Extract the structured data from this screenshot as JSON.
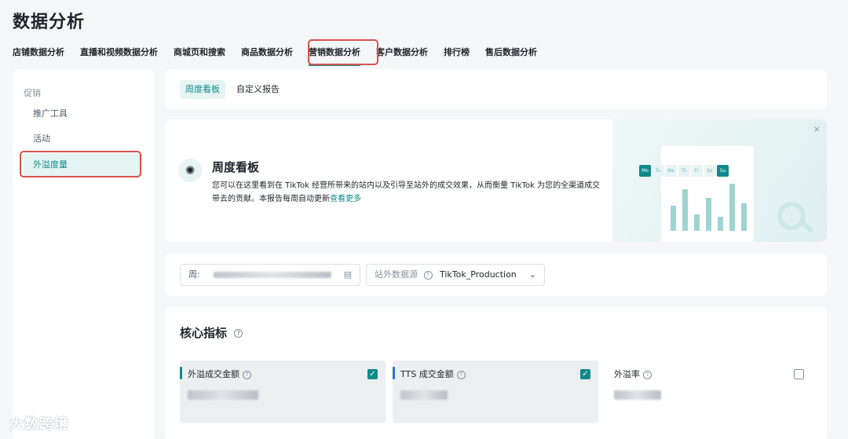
{
  "page": {
    "title": "数据分析"
  },
  "top_nav": [
    {
      "label": "店铺数据分析"
    },
    {
      "label": "直播和视频数据分析"
    },
    {
      "label": "商城页和搜索"
    },
    {
      "label": "商品数据分析"
    },
    {
      "label": "营销数据分析",
      "active": true
    },
    {
      "label": "客户数据分析"
    },
    {
      "label": "排行榜"
    },
    {
      "label": "售后数据分析"
    }
  ],
  "sidebar": {
    "section": "促销",
    "items": [
      {
        "label": "推广工具"
      },
      {
        "label": "活动"
      },
      {
        "label": "外溢度量",
        "active": true
      }
    ]
  },
  "tabs": [
    {
      "label": "周度看板",
      "active": true
    },
    {
      "label": "自定义报告"
    }
  ],
  "banner": {
    "title": "周度看板",
    "description": "您可以在这里看到在 TikTok 经营所带来的站内以及引导至站外的成交效果，从而衡量 TikTok 为您的全渠道成交带去的贡献。本报告每周自动更新",
    "link": "查看更多",
    "close": "×",
    "weekdays": [
      "Mo",
      "Tu",
      "We",
      "Th",
      "Fr",
      "Sa",
      "Su"
    ],
    "bar_levels": [
      0.45,
      0.75,
      0.3,
      0.6,
      0.25,
      0.85,
      0.5
    ]
  },
  "filters": {
    "week_label": "周:",
    "source_label": "站外数据源",
    "source_value": "TikTok_Production",
    "help": "?",
    "calendar_icon": "calendar-icon",
    "chevron_icon": "chevron-down-icon"
  },
  "metrics": {
    "title": "核心指标",
    "help": "?",
    "items": [
      {
        "label": "外溢成交金额",
        "checked": true,
        "accent": "#0f8a8a"
      },
      {
        "label": "TTS 成交金额",
        "checked": true,
        "accent": "#2f6fd6"
      },
      {
        "label": "外溢率",
        "checked": false
      }
    ]
  },
  "watermark": "大数跨境",
  "colors": {
    "accent": "#0f8a8a",
    "highlight": "#d9534f",
    "bg": "#f5f6f7"
  }
}
